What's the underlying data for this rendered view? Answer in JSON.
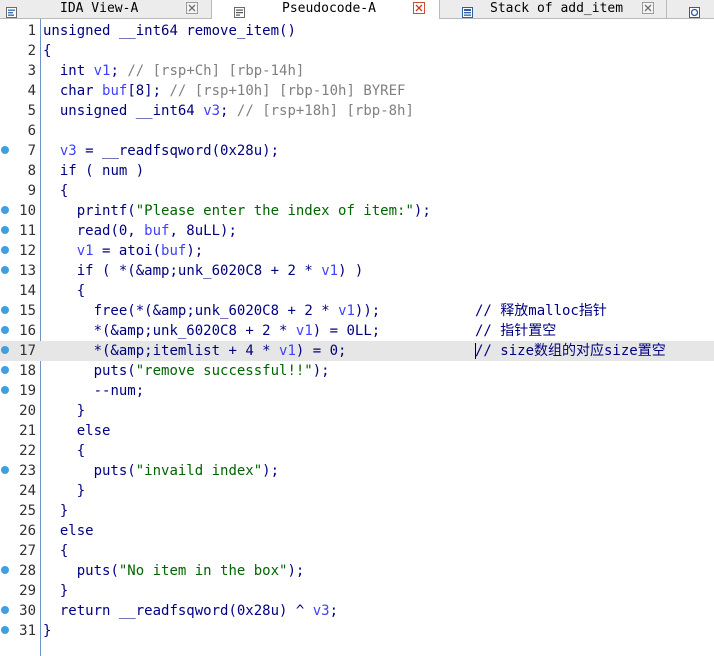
{
  "tabs": [
    {
      "label": "IDA View-A",
      "icon": "ida-view-icon"
    },
    {
      "label": "Pseudocode-A",
      "icon": "pseudocode-icon"
    },
    {
      "label": "Stack of add_item",
      "icon": "stack-icon"
    },
    {
      "label": "",
      "icon": "hexview-icon"
    }
  ],
  "code": {
    "lines": [
      {
        "n": "1",
        "t": "unsigned __int64 remove_item()"
      },
      {
        "n": "2",
        "t": "{"
      },
      {
        "n": "3",
        "t": "  int v1; // [rsp+Ch] [rbp-14h]"
      },
      {
        "n": "4",
        "t": "  char buf[8]; // [rsp+10h] [rbp-10h] BYREF"
      },
      {
        "n": "5",
        "t": "  unsigned __int64 v3; // [rsp+18h] [rbp-8h]"
      },
      {
        "n": "6",
        "t": ""
      },
      {
        "n": "7",
        "t": "  v3 = __readfsqword(0x28u);"
      },
      {
        "n": "8",
        "t": "  if ( num )"
      },
      {
        "n": "9",
        "t": "  {"
      },
      {
        "n": "10",
        "t": "    printf(\"Please enter the index of item:\");"
      },
      {
        "n": "11",
        "t": "    read(0, buf, 8uLL);"
      },
      {
        "n": "12",
        "t": "    v1 = atoi(buf);"
      },
      {
        "n": "13",
        "t": "    if ( *(&unk_6020C8 + 2 * v1) )"
      },
      {
        "n": "14",
        "t": "    {"
      },
      {
        "n": "15",
        "t": "      free(*(&unk_6020C8 + 2 * v1));"
      },
      {
        "n": "16",
        "t": "      *(&unk_6020C8 + 2 * v1) = 0LL;"
      },
      {
        "n": "17",
        "t": "      *(&itemlist + 4 * v1) = 0;"
      },
      {
        "n": "18",
        "t": "      puts(\"remove successful!!\");"
      },
      {
        "n": "19",
        "t": "      --num;"
      },
      {
        "n": "20",
        "t": "    }"
      },
      {
        "n": "21",
        "t": "    else"
      },
      {
        "n": "22",
        "t": "    {"
      },
      {
        "n": "23",
        "t": "      puts(\"invaild index\");"
      },
      {
        "n": "24",
        "t": "    }"
      },
      {
        "n": "25",
        "t": "  }"
      },
      {
        "n": "26",
        "t": "  else"
      },
      {
        "n": "27",
        "t": "  {"
      },
      {
        "n": "28",
        "t": "    puts(\"No item in the box\");"
      },
      {
        "n": "29",
        "t": "  }"
      },
      {
        "n": "30",
        "t": "  return __readfsqword(0x28u) ^ v3;"
      },
      {
        "n": "31",
        "t": "}"
      }
    ],
    "comments": {
      "15": "// 释放malloc指针",
      "16": "// 指针置空",
      "17": "// size数组的对应size置空"
    },
    "breakpoint_lines": [
      "7",
      "10",
      "11",
      "12",
      "13",
      "15",
      "16",
      "17",
      "18",
      "19",
      "23",
      "28",
      "30",
      "31"
    ],
    "highlighted_line": "17"
  },
  "colors": {
    "keyword": "#000080",
    "string": "#006400",
    "comment": "#808080",
    "variable": "#3f3fff",
    "highlight": "#e6e6e6",
    "breakpoint": "#3f9fe0"
  }
}
